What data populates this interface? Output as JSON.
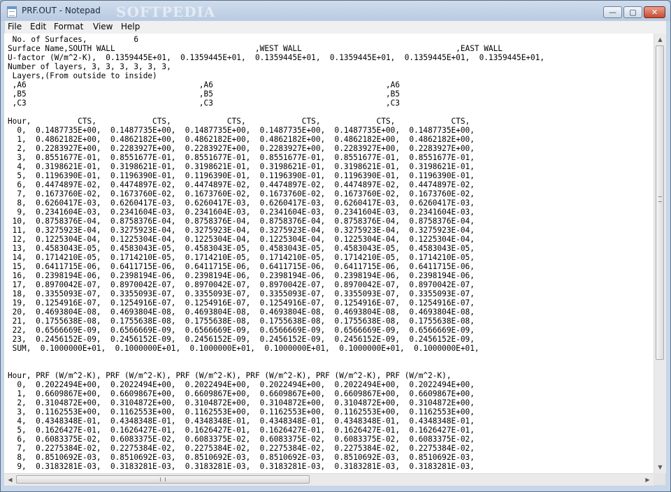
{
  "window": {
    "title": "PRF.OUT - Notepad",
    "watermark": "SOFTPEDIA",
    "buttons": {
      "minimize": "—",
      "maximize": "▢",
      "close": "✕"
    }
  },
  "menu": [
    "File",
    "Edit",
    "Format",
    "View",
    "Help"
  ],
  "icons": {
    "app": "notepad-icon",
    "scroll_up": "▲",
    "scroll_down": "▼",
    "scroll_left": "◀",
    "scroll_right": "▶"
  },
  "document": {
    "lines": [
      " No. of Surfaces,          6",
      "Surface Name,SOUTH WALL                              ,WEST WALL                                 ,EAST WALL",
      "U-factor (W/m^2-K),  0.1359445E+01,  0.1359445E+01,  0.1359445E+01,  0.1359445E+01,  0.1359445E+01,  0.1359445E+01,",
      "Number of layers, 3, 3, 3, 3, 3, 3,",
      " Layers,(From outside to inside)",
      " ,A6                                     ,A6                                     ,A6",
      " ,B5                                     ,B5                                     ,B5",
      " ,C3                                     ,C3                                     ,C3",
      "",
      "Hour,          CTS,            CTS,            CTS,            CTS,            CTS,            CTS,",
      "  0,  0.1487735E+00,  0.1487735E+00,  0.1487735E+00,  0.1487735E+00,  0.1487735E+00,  0.1487735E+00,",
      "  1,  0.4862182E+00,  0.4862182E+00,  0.4862182E+00,  0.4862182E+00,  0.4862182E+00,  0.4862182E+00,",
      "  2,  0.2283927E+00,  0.2283927E+00,  0.2283927E+00,  0.2283927E+00,  0.2283927E+00,  0.2283927E+00,",
      "  3,  0.8551677E-01,  0.8551677E-01,  0.8551677E-01,  0.8551677E-01,  0.8551677E-01,  0.8551677E-01,",
      "  4,  0.3198621E-01,  0.3198621E-01,  0.3198621E-01,  0.3198621E-01,  0.3198621E-01,  0.3198621E-01,",
      "  5,  0.1196390E-01,  0.1196390E-01,  0.1196390E-01,  0.1196390E-01,  0.1196390E-01,  0.1196390E-01,",
      "  6,  0.4474897E-02,  0.4474897E-02,  0.4474897E-02,  0.4474897E-02,  0.4474897E-02,  0.4474897E-02,",
      "  7,  0.1673760E-02,  0.1673760E-02,  0.1673760E-02,  0.1673760E-02,  0.1673760E-02,  0.1673760E-02,",
      "  8,  0.6260417E-03,  0.6260417E-03,  0.6260417E-03,  0.6260417E-03,  0.6260417E-03,  0.6260417E-03,",
      "  9,  0.2341604E-03,  0.2341604E-03,  0.2341604E-03,  0.2341604E-03,  0.2341604E-03,  0.2341604E-03,",
      " 10,  0.8758376E-04,  0.8758376E-04,  0.8758376E-04,  0.8758376E-04,  0.8758376E-04,  0.8758376E-04,",
      " 11,  0.3275923E-04,  0.3275923E-04,  0.3275923E-04,  0.3275923E-04,  0.3275923E-04,  0.3275923E-04,",
      " 12,  0.1225304E-04,  0.1225304E-04,  0.1225304E-04,  0.1225304E-04,  0.1225304E-04,  0.1225304E-04,",
      " 13,  0.4583043E-05,  0.4583043E-05,  0.4583043E-05,  0.4583043E-05,  0.4583043E-05,  0.4583043E-05,",
      " 14,  0.1714210E-05,  0.1714210E-05,  0.1714210E-05,  0.1714210E-05,  0.1714210E-05,  0.1714210E-05,",
      " 15,  0.6411715E-06,  0.6411715E-06,  0.6411715E-06,  0.6411715E-06,  0.6411715E-06,  0.6411715E-06,",
      " 16,  0.2398194E-06,  0.2398194E-06,  0.2398194E-06,  0.2398194E-06,  0.2398194E-06,  0.2398194E-06,",
      " 17,  0.8970042E-07,  0.8970042E-07,  0.8970042E-07,  0.8970042E-07,  0.8970042E-07,  0.8970042E-07,",
      " 18,  0.3355093E-07,  0.3355093E-07,  0.3355093E-07,  0.3355093E-07,  0.3355093E-07,  0.3355093E-07,",
      " 19,  0.1254916E-07,  0.1254916E-07,  0.1254916E-07,  0.1254916E-07,  0.1254916E-07,  0.1254916E-07,",
      " 20,  0.4693804E-08,  0.4693804E-08,  0.4693804E-08,  0.4693804E-08,  0.4693804E-08,  0.4693804E-08,",
      " 21,  0.1755638E-08,  0.1755638E-08,  0.1755638E-08,  0.1755638E-08,  0.1755638E-08,  0.1755638E-08,",
      " 22,  0.6566669E-09,  0.6566669E-09,  0.6566669E-09,  0.6566669E-09,  0.6566669E-09,  0.6566669E-09,",
      " 23,  0.2456152E-09,  0.2456152E-09,  0.2456152E-09,  0.2456152E-09,  0.2456152E-09,  0.2456152E-09,",
      " SUM,  0.1000000E+01,  0.1000000E+01,  0.1000000E+01,  0.1000000E+01,  0.1000000E+01,  0.1000000E+01,",
      "",
      "",
      "Hour, PRF (W/m^2-K), PRF (W/m^2-K), PRF (W/m^2-K), PRF (W/m^2-K), PRF (W/m^2-K), PRF (W/m^2-K),",
      "  0,  0.2022494E+00,  0.2022494E+00,  0.2022494E+00,  0.2022494E+00,  0.2022494E+00,  0.2022494E+00,",
      "  1,  0.6609867E+00,  0.6609867E+00,  0.6609867E+00,  0.6609867E+00,  0.6609867E+00,  0.6609867E+00,",
      "  2,  0.3104872E+00,  0.3104872E+00,  0.3104872E+00,  0.3104872E+00,  0.3104872E+00,  0.3104872E+00,",
      "  3,  0.1162553E+00,  0.1162553E+00,  0.1162553E+00,  0.1162553E+00,  0.1162553E+00,  0.1162553E+00,",
      "  4,  0.4348348E-01,  0.4348348E-01,  0.4348348E-01,  0.4348348E-01,  0.4348348E-01,  0.4348348E-01,",
      "  5,  0.1626427E-01,  0.1626427E-01,  0.1626427E-01,  0.1626427E-01,  0.1626427E-01,  0.1626427E-01,",
      "  6,  0.6083375E-02,  0.6083375E-02,  0.6083375E-02,  0.6083375E-02,  0.6083375E-02,  0.6083375E-02,",
      "  7,  0.2275384E-02,  0.2275384E-02,  0.2275384E-02,  0.2275384E-02,  0.2275384E-02,  0.2275384E-02,",
      "  8,  0.8510692E-03,  0.8510692E-03,  0.8510692E-03,  0.8510692E-03,  0.8510692E-03,  0.8510692E-03,",
      "  9,  0.3183281E-03,  0.3183281E-03,  0.3183281E-03,  0.3183281E-03,  0.3183281E-03,  0.3183281E-03,"
    ]
  },
  "colors": {
    "titlebar": "#b9cbe2",
    "close_button": "#c64a32",
    "editor_bg": "#ffffff"
  }
}
